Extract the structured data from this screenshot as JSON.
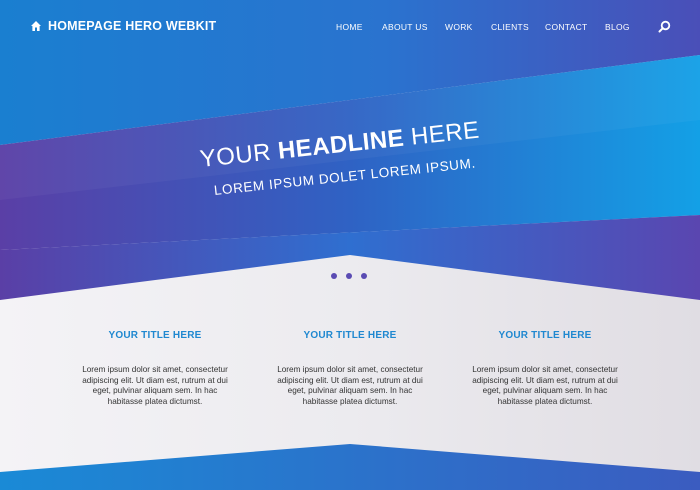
{
  "brand": {
    "title": "HOMEPAGE HERO WEBKIT",
    "icon": "home-icon"
  },
  "nav": {
    "items": [
      "HOME",
      "ABOUT US",
      "WORK",
      "CLIENTS",
      "CONTACT",
      "BLOG"
    ],
    "search_icon": "search-icon"
  },
  "hero": {
    "headline_pre": "YOUR ",
    "headline_bold": "HEADLINE",
    "headline_post": " HERE",
    "subheadline": "LOREM IPSUM DOLET LOREM IPSUM."
  },
  "features": [
    {
      "title": "YOUR TITLE HERE",
      "body": "Lorem ipsum dolor sit amet, consectetur adipiscing elit. Ut diam est, rutrum at dui eget, pulvinar aliquam sem. In hac habitasse platea dictumst."
    },
    {
      "title": "YOUR TITLE HERE",
      "body": "Lorem ipsum dolor sit amet, consectetur adipiscing elit. Ut diam est, rutrum at dui eget, pulvinar aliquam sem. In hac habitasse platea dictumst."
    },
    {
      "title": "YOUR TITLE HERE",
      "body": "Lorem ipsum dolor sit amet, consectetur adipiscing elit. Ut diam est, rutrum at dui eget, pulvinar aliquam sem. In hac habitasse platea dictumst."
    }
  ],
  "colors": {
    "hero_blue": "#1a8ad6",
    "hero_purple": "#5a3fa6",
    "accent_title": "#1f88d0",
    "dot": "#5a4bb3"
  }
}
